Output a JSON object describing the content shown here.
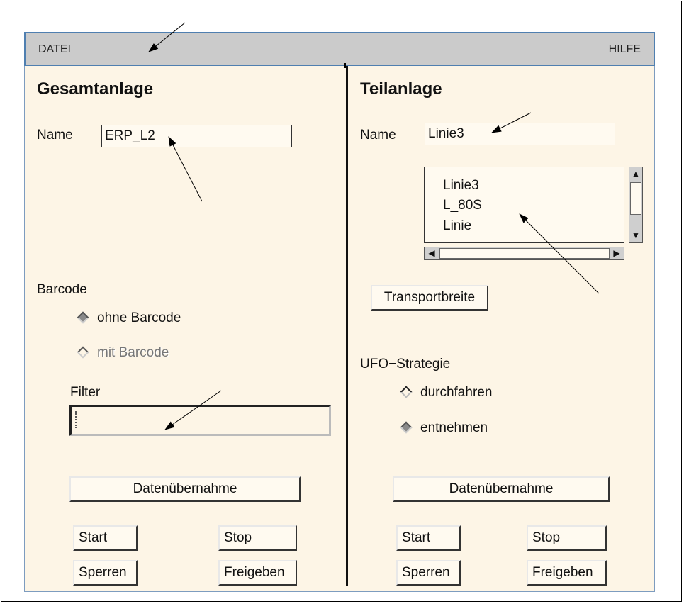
{
  "menubar": {
    "file": "DATEI",
    "help": "HILFE"
  },
  "left": {
    "title": "Gesamtanlage",
    "name_label": "Name",
    "name_value": "ERP_L2",
    "barcode_label": "Barcode",
    "barcode_options": [
      {
        "label": "ohne Barcode",
        "selected": true,
        "enabled": true
      },
      {
        "label": "mit Barcode",
        "selected": false,
        "enabled": false
      }
    ],
    "filter_label": "Filter",
    "filter_value": "",
    "transfer_button": "Datenübernahme",
    "start_button": "Start",
    "stop_button": "Stop",
    "lock_button": "Sperren",
    "release_button": "Freigeben"
  },
  "right": {
    "title": "Teilanlage",
    "name_label": "Name",
    "name_value": "Linie3",
    "list_items": [
      "Linie3",
      "L_80S",
      "Linie"
    ],
    "transport_button": "Transportbreite",
    "ufo_label": "UFO−Strategie",
    "ufo_options": [
      {
        "label": "durchfahren",
        "selected": false
      },
      {
        "label": "entnehmen",
        "selected": true
      }
    ],
    "transfer_button": "Datenübernahme",
    "start_button": "Start",
    "stop_button": "Stop",
    "lock_button": "Sperren",
    "release_button": "Freigeben"
  }
}
